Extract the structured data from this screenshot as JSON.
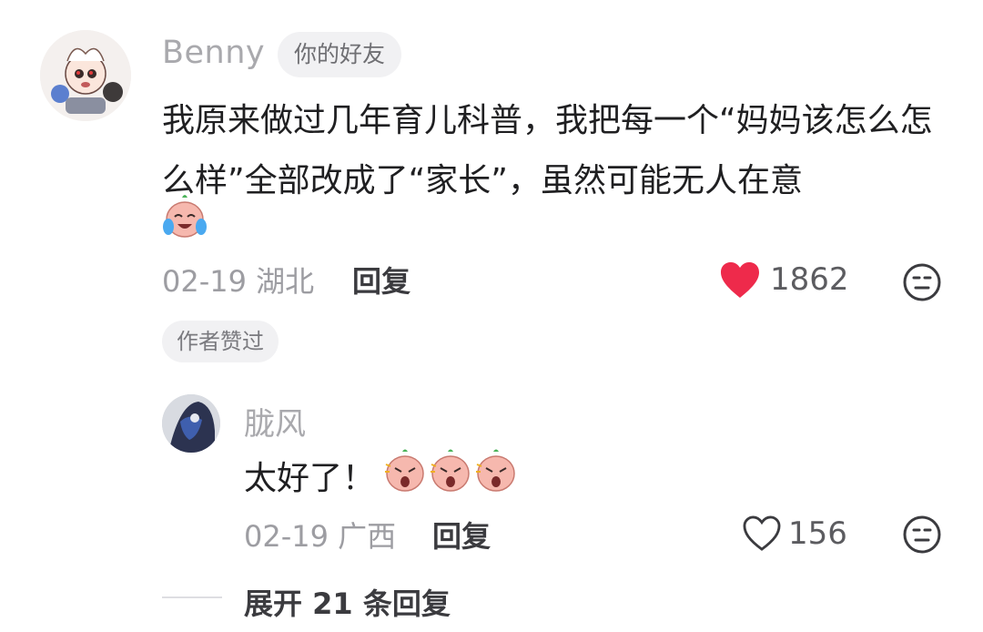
{
  "comment": {
    "author": "Benny",
    "badge": "你的好友",
    "text": "我原来做过几年育儿科普，我把每一个“妈妈该怎么怎么样”全部改成了“家长”，虽然可能无人在意",
    "emoji_after_text": "crying-laugh-emoji",
    "date": "02-19",
    "location": "湖北",
    "reply_label": "回复",
    "likes": "1862",
    "liked": true,
    "author_liked_badge": "作者赞过",
    "colors": {
      "heart_liked": "#ee2a4b",
      "muted_text": "#9d9da2"
    }
  },
  "reply": {
    "author": "胧风",
    "text": "太好了！",
    "emojis": [
      "shocked-emoji",
      "shocked-emoji",
      "shocked-emoji"
    ],
    "date": "02-19",
    "location": "广西",
    "reply_label": "回复",
    "likes": "156",
    "liked": false
  },
  "expand": {
    "label": "展开 21 条回复"
  }
}
